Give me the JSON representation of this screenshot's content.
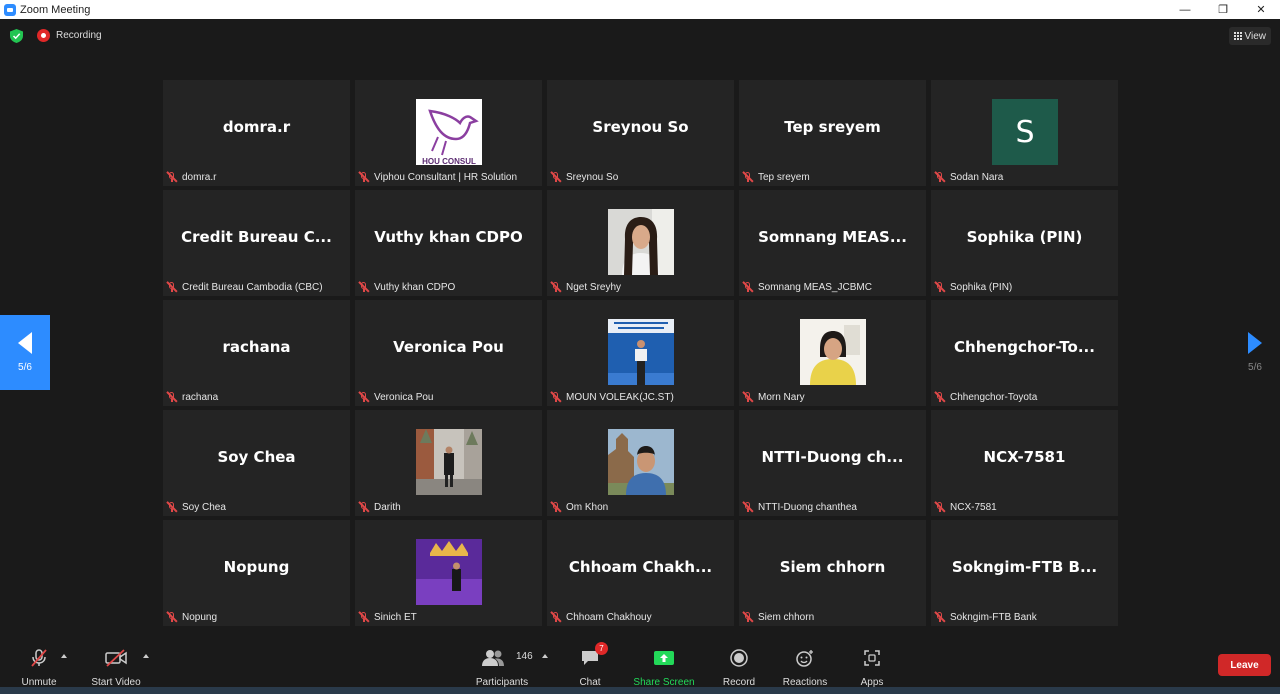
{
  "window": {
    "title": "Zoom Meeting"
  },
  "status": {
    "recording_label": "Recording",
    "view_label": "View"
  },
  "pagination": {
    "left_label": "5/6",
    "right_label": "5/6"
  },
  "participants": [
    {
      "display": "domra.r",
      "caption": "domra.r"
    },
    {
      "display": "",
      "caption": "Viphou Consultant | HR Solution"
    },
    {
      "display": "Sreynou So",
      "caption": "Sreynou So"
    },
    {
      "display": "Tep sreyem",
      "caption": "Tep sreyem"
    },
    {
      "display": "",
      "caption": "Sodan Nara",
      "avatar_letter": "S"
    },
    {
      "display": "Credit Bureau C...",
      "caption": "Credit Bureau Cambodia (CBC)"
    },
    {
      "display": "Vuthy khan CDPO",
      "caption": "Vuthy khan CDPO"
    },
    {
      "display": "",
      "caption": "Nget Sreyhy"
    },
    {
      "display": "Somnang  MEAS...",
      "caption": "Somnang MEAS_JCBMC"
    },
    {
      "display": "Sophika (PIN)",
      "caption": "Sophika (PIN)"
    },
    {
      "display": "rachana",
      "caption": "rachana"
    },
    {
      "display": "Veronica Pou",
      "caption": "Veronica Pou"
    },
    {
      "display": "",
      "caption": "MOUN VOLEAK(JC.ST)"
    },
    {
      "display": "",
      "caption": "Morn Nary"
    },
    {
      "display": "Chhengchor-To...",
      "caption": "Chhengchor-Toyota"
    },
    {
      "display": "Soy Chea",
      "caption": "Soy Chea"
    },
    {
      "display": "",
      "caption": "Darith"
    },
    {
      "display": "",
      "caption": "Om Khon"
    },
    {
      "display": "NTTI-Duong  ch...",
      "caption": "NTTI-Duong chanthea"
    },
    {
      "display": "NCX-7581",
      "caption": "NCX-7581"
    },
    {
      "display": "Nopung",
      "caption": "Nopung"
    },
    {
      "display": "",
      "caption": "Sinich ET"
    },
    {
      "display": "Chhoam  Chakh...",
      "caption": "Chhoam Chakhouy"
    },
    {
      "display": "Siem chhorn",
      "caption": "Siem chhorn"
    },
    {
      "display": "Sokngim-FTB  B...",
      "caption": "Sokngim-FTB Bank"
    }
  ],
  "logo_text": "HOU CONSUL",
  "toolbar": {
    "unmute": "Unmute",
    "start_video": "Start Video",
    "participants": "Participants",
    "participant_count": "146",
    "chat": "Chat",
    "chat_badge": "7",
    "share_screen": "Share Screen",
    "record": "Record",
    "reactions": "Reactions",
    "apps": "Apps",
    "leave": "Leave"
  },
  "colors": {
    "accent": "#2d8cff",
    "share_green": "#23d959",
    "danger": "#d02828",
    "tile": "#242424"
  }
}
